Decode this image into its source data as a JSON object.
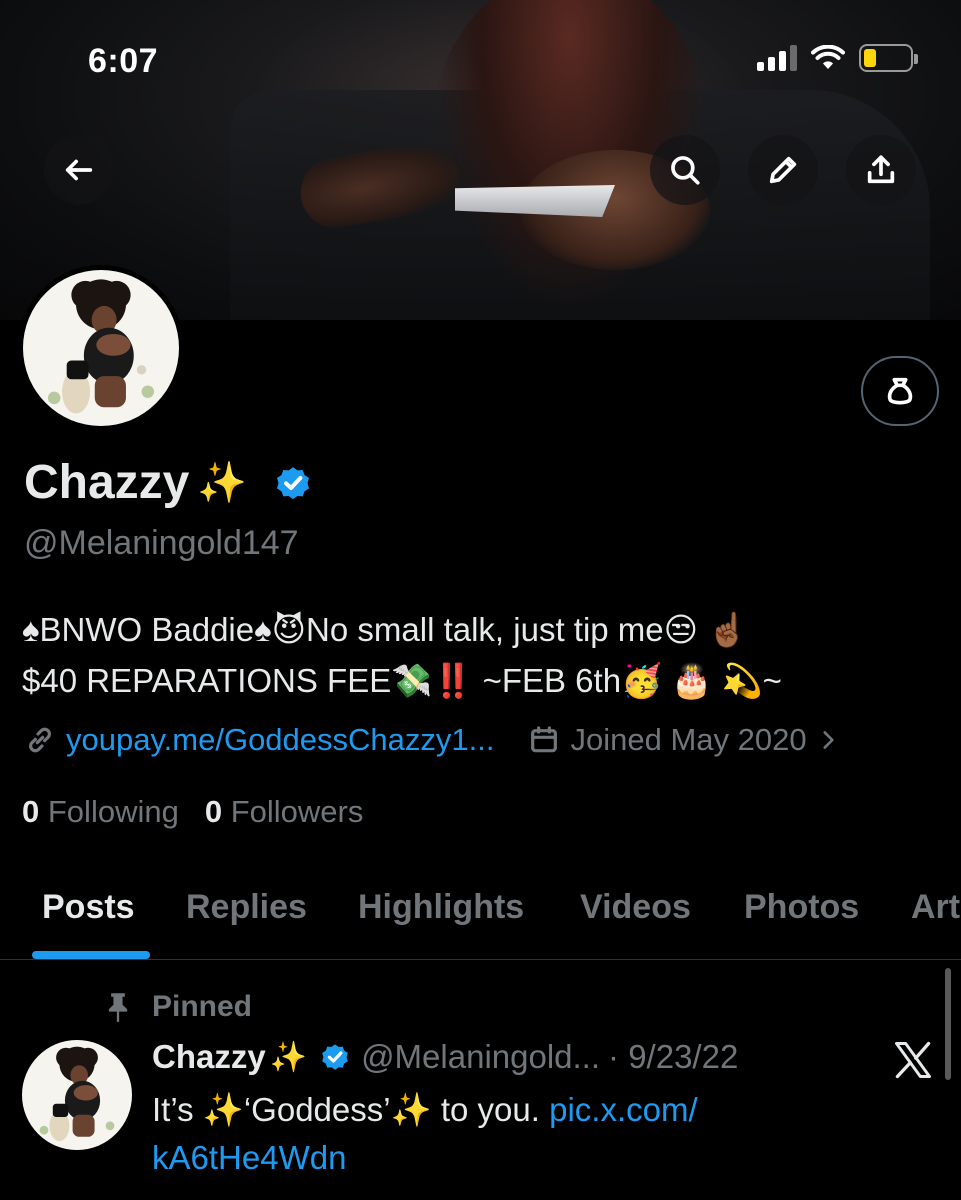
{
  "status_bar": {
    "time": "6:07",
    "battery_color": "#ffd60a"
  },
  "header": {
    "back_icon": "arrow-left-icon",
    "search_icon": "search-icon",
    "edit_icon": "pencil-icon",
    "share_icon": "share-icon"
  },
  "profile": {
    "display_name": "Chazzy",
    "name_emoji": "✨",
    "handle": "@Melaningold147",
    "bio_line1": "♠BNWO Baddie♠😈No small talk, just tip me😒 ☝🏾",
    "bio_line2": "$40 REPARATIONS FEE💸‼️ ~FEB 6th🥳 🎂 💫~",
    "website": "youpay.me/GoddessChazzy1...",
    "joined": "Joined May 2020",
    "following_count": "0",
    "following_label": "Following",
    "followers_count": "0",
    "followers_label": "Followers",
    "accent_color": "#1d9bf0"
  },
  "tabs": [
    {
      "label": "Posts"
    },
    {
      "label": "Replies"
    },
    {
      "label": "Highlights"
    },
    {
      "label": "Videos"
    },
    {
      "label": "Photos"
    },
    {
      "label": "Art"
    }
  ],
  "pinned_post": {
    "pinned_label": "Pinned",
    "author_name": "Chazzy",
    "author_emoji": "✨",
    "author_handle": "@Melaningold...",
    "date": "· 9/23/22",
    "text_prefix": "It’s ",
    "text_sparkle1": "✨",
    "text_middle": "‘Goddess’",
    "text_sparkle2": "✨",
    "text_suffix": "to you. ",
    "link_part1": "pic.x.com/",
    "link_part2": "kA6tHe4Wdn"
  }
}
